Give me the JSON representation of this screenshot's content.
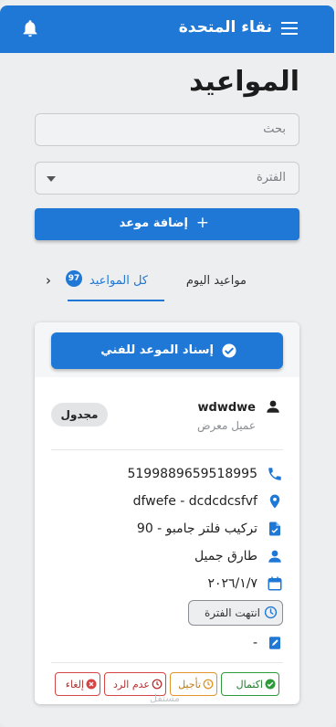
{
  "app": {
    "title": "نقاء المتحدة"
  },
  "page": {
    "title": "المواعيد"
  },
  "search": {
    "placeholder": "بحث"
  },
  "period_select": {
    "value": "الفترة"
  },
  "add_button": {
    "label": "إضافة موعد"
  },
  "tabs": [
    {
      "label": "مواعيد اليوم",
      "active": false
    },
    {
      "label": "كل المواعيد",
      "active": true,
      "badge": "97"
    }
  ],
  "appointment": {
    "assign_label": "إسناد الموعد للفني",
    "customer_name": "wdwdwe",
    "customer_type": "عميل معرض",
    "status": "مجدول",
    "phone": "5199889659518995",
    "address": "dfwefe - dcdcdcsfvf",
    "service": "تركيب فلتر جامبو - 90",
    "technician": "طارق جميل",
    "date": "٢٠٢٦/١/٧",
    "period_status": "انتهت الفترة",
    "notes": "-",
    "actions": {
      "complete": "اكتمال",
      "postpone": "تأجيل",
      "no_answer": "عدم الرد",
      "cancel": "إلغاء"
    }
  },
  "colors": {
    "primary": "#1f78d6",
    "complete": "#2e9b3a",
    "postpone": "#e0962a",
    "no_answer": "#d64545",
    "cancel": "#d64545"
  },
  "watermark": "مستقل"
}
